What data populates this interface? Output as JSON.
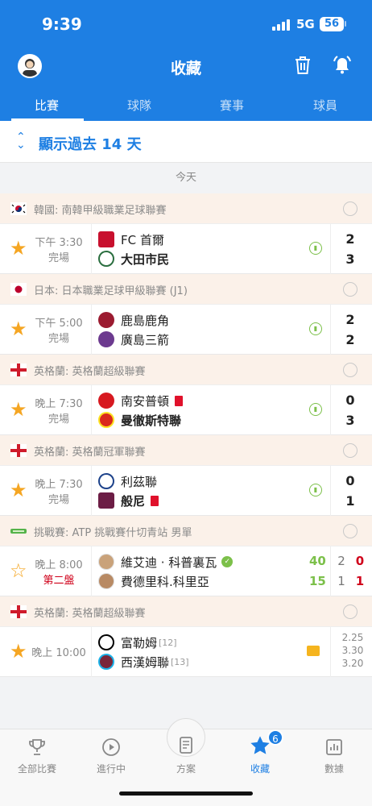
{
  "status_bar": {
    "time": "9:39",
    "network": "5G",
    "battery": "56"
  },
  "header": {
    "title": "收藏"
  },
  "tabs": [
    {
      "label": "比賽",
      "active": true
    },
    {
      "label": "球隊",
      "active": false
    },
    {
      "label": "賽事",
      "active": false
    },
    {
      "label": "球員",
      "active": false
    }
  ],
  "range": {
    "label": "顯示過去 14 天"
  },
  "day_label": "今天",
  "leagues": [
    {
      "name": "韓國: 南韓甲級職業足球聯賽",
      "flag": "korea"
    },
    {
      "name": "日本: 日本職業足球甲級聯賽 (J1)",
      "flag": "japan"
    },
    {
      "name": "英格蘭: 英格蘭超級聯賽",
      "flag": "england"
    },
    {
      "name": "英格蘭: 英格蘭冠軍聯賽",
      "flag": "england"
    },
    {
      "name": "挑戰賽: ATP 挑戰賽什切青站 男單",
      "flag": "atp"
    },
    {
      "name": "英格蘭: 英格蘭超級聯賽",
      "flag": "england"
    }
  ],
  "matches": [
    {
      "time": "下午 3:30",
      "status": "完場",
      "home": "FC 首爾",
      "away": "大田市民",
      "home_score": "2",
      "away_score": "3",
      "favorite": true
    },
    {
      "time": "下午 5:00",
      "status": "完場",
      "home": "鹿島鹿角",
      "away": "廣島三箭",
      "home_score": "2",
      "away_score": "2",
      "favorite": true
    },
    {
      "time": "晚上 7:30",
      "status": "完場",
      "home": "南安普頓",
      "away": "曼徹斯特聯",
      "home_score": "0",
      "away_score": "3",
      "home_red_cards": 1,
      "favorite": true
    },
    {
      "time": "晚上 7:30",
      "status": "完場",
      "home": "利茲聯",
      "away": "般尼",
      "home_score": "0",
      "away_score": "1",
      "away_red_cards": 1,
      "favorite": true
    },
    {
      "time": "晚上 8:00",
      "status": "第二盤",
      "home": "維艾迪 · 科普裏瓦",
      "away": "費德里科.科里亞",
      "home_points": "40",
      "away_points": "15",
      "home_set1": "2",
      "away_set1": "1",
      "home_set2": "0",
      "away_set2": "1",
      "favorite": false
    },
    {
      "time": "晚上 10:00",
      "status": "",
      "home": "富勒姆",
      "home_rank": "[12]",
      "away": "西漢姆聯",
      "away_rank": "[13]",
      "odds": [
        "2.25",
        "3.30",
        "3.20"
      ],
      "favorite": true
    }
  ],
  "bottom_nav": [
    {
      "label": "全部比賽",
      "icon": "trophy-icon"
    },
    {
      "label": "進行中",
      "icon": "play-icon"
    },
    {
      "label": "方案",
      "icon": "plan-icon"
    },
    {
      "label": "收藏",
      "icon": "star-icon",
      "badge": "6",
      "active": true
    },
    {
      "label": "數據",
      "icon": "stats-icon"
    }
  ],
  "colors": {
    "primary": "#1e7fe3",
    "star": "#f5a623",
    "red": "#e0112b",
    "green": "#7cc04a",
    "league_bg": "#fbf1e9"
  }
}
